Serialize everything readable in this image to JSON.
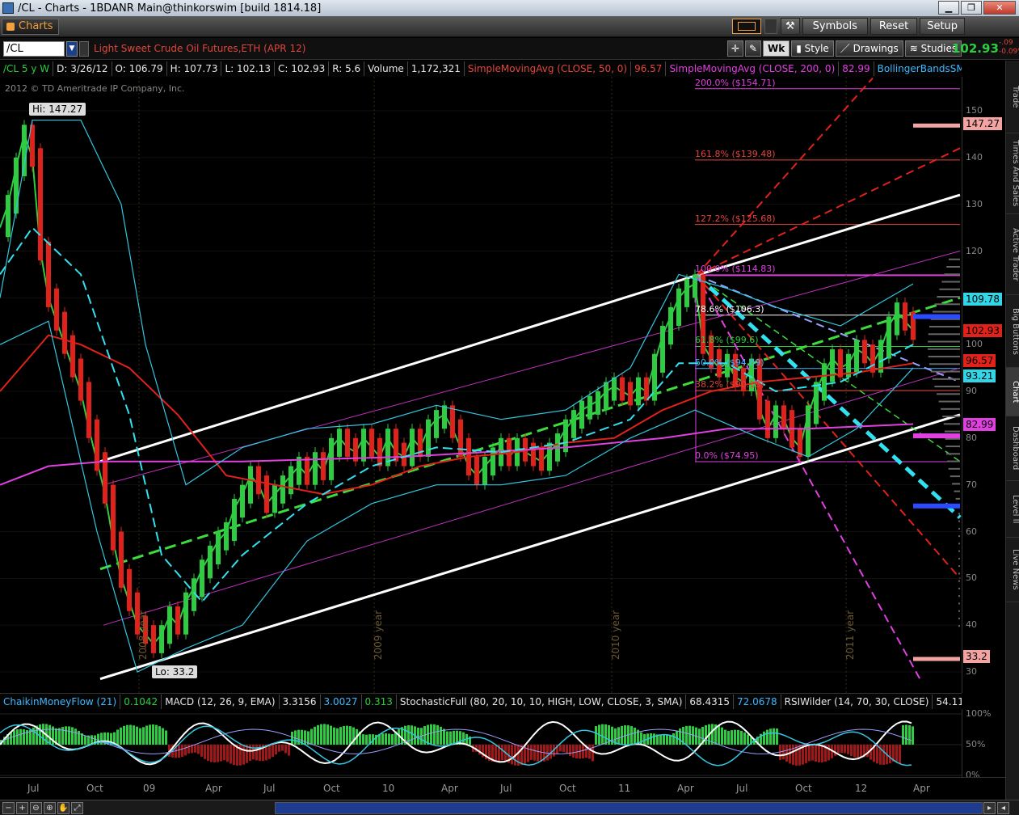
{
  "window": {
    "title": "/CL - Charts - 1BDANR Main@thinkorswim [build 1814.18]"
  },
  "toolbar": {
    "charts_tab": "Charts",
    "symbols_btn": "Symbols",
    "reset_btn": "Reset",
    "setup_btn": "Setup"
  },
  "symbol_bar": {
    "symbol": "/CL",
    "description": "Light Sweet Crude Oil Futures,ETH (APR 12)",
    "wk_btn": "Wk",
    "style_btn": "Style",
    "drawings_btn": "Drawings",
    "studies_btn": "Studies",
    "last_price": "102.93",
    "change": "-.09",
    "change_pct": "-0.09%"
  },
  "info_bar": {
    "series": "/CL 5 y W",
    "date": "D: 3/26/12",
    "open": "O: 106.79",
    "high": "H: 107.73",
    "low": "L: 102.13",
    "close": "C: 102.93",
    "range": "R: 5.6",
    "volume_label": "Volume",
    "volume": "1,172,321",
    "sma50_label": "SimpleMovingAvg (CLOSE, 50, 0)",
    "sma50": "96.57",
    "sma200_label": "SimpleMovingAvg (CLOSE, 200, 0)",
    "sma200": "82.99",
    "bb_label": "BollingerBandsSMA (..."
  },
  "chart": {
    "copyright": "2012 © TD Ameritrade IP Company, Inc.",
    "hi_label": "Hi: 147.27",
    "lo_label": "Lo: 33.2",
    "year_labels": [
      "2008 year",
      "2009 year",
      "2010 year",
      "2011 year"
    ],
    "fib_levels": [
      {
        "label": "200.0%  ($154.71)",
        "value": 154.71,
        "color": "#e040e0"
      },
      {
        "label": "161.8%  ($139.48)",
        "value": 139.48,
        "color": "#e0463c"
      },
      {
        "label": "127.2%  ($125.68)",
        "value": 125.68,
        "color": "#e0463c"
      },
      {
        "label": "100.0%  ($114.83)",
        "value": 114.83,
        "color": "#e040e0"
      },
      {
        "label": "78.6%  ($106.3)",
        "value": 106.3,
        "color": "#ffffff"
      },
      {
        "label": "61.8%  ($99.6)",
        "value": 99.6,
        "color": "#2ecc40"
      },
      {
        "label": "50.0%  ($94.89)",
        "value": 94.89,
        "color": "#3fb6ff"
      },
      {
        "label": "38.2%  ($90.18)",
        "value": 90.18,
        "color": "#e0463c"
      },
      {
        "label": "0.0%  ($74.95)",
        "value": 74.95,
        "color": "#e040e0"
      }
    ]
  },
  "price_axis": {
    "ticks": [
      "150",
      "140",
      "130",
      "120",
      "110",
      "100",
      "90",
      "80",
      "70",
      "60",
      "50",
      "40",
      "30"
    ],
    "badges": [
      {
        "text": "147.27",
        "bg": "#f4a3a3",
        "value": 147.27
      },
      {
        "text": "109.78",
        "bg": "#33d6e6",
        "value": 109.78
      },
      {
        "text": "102.93",
        "bg": "#e0221a",
        "value": 102.93
      },
      {
        "text": "96.57",
        "bg": "#e0221a",
        "value": 96.57
      },
      {
        "text": "93.21",
        "bg": "#33d6e6",
        "value": 93.21
      },
      {
        "text": "82.99",
        "bg": "#e040e0",
        "value": 82.99
      },
      {
        "text": "33.2",
        "bg": "#f4a3a3",
        "value": 33.2
      }
    ]
  },
  "lower_bar": {
    "cmf_label": "ChaikinMoneyFlow (21)",
    "cmf": "0.1042",
    "macd_label": "MACD (12, 26, 9, EMA)",
    "macd1": "3.3156",
    "macd2": "3.0027",
    "macd3": "0.313",
    "stoch_label": "StochasticFull (80, 20, 10, 10, HIGH, LOW, CLOSE, 3, SMA)",
    "stoch1": "68.4315",
    "stoch2": "72.0678",
    "rsi_label": "RSIWilder (14, 70, 30, CLOSE)",
    "rsi": "54.1173"
  },
  "lower_axis": {
    "ticks": [
      "100%",
      "50%",
      "0%"
    ]
  },
  "time_axis": {
    "labels": [
      "Jul",
      "Oct",
      "09",
      "Apr",
      "Jul",
      "Oct",
      "10",
      "Apr",
      "Jul",
      "Oct",
      "11",
      "Apr",
      "Jul",
      "Oct",
      "12",
      "Apr"
    ]
  },
  "side_tabs": [
    "Trade",
    "Times And Sales",
    "Active Trader",
    "Big Buttons",
    "Chart",
    "Dashboard",
    "Level II",
    "Live News"
  ]
}
